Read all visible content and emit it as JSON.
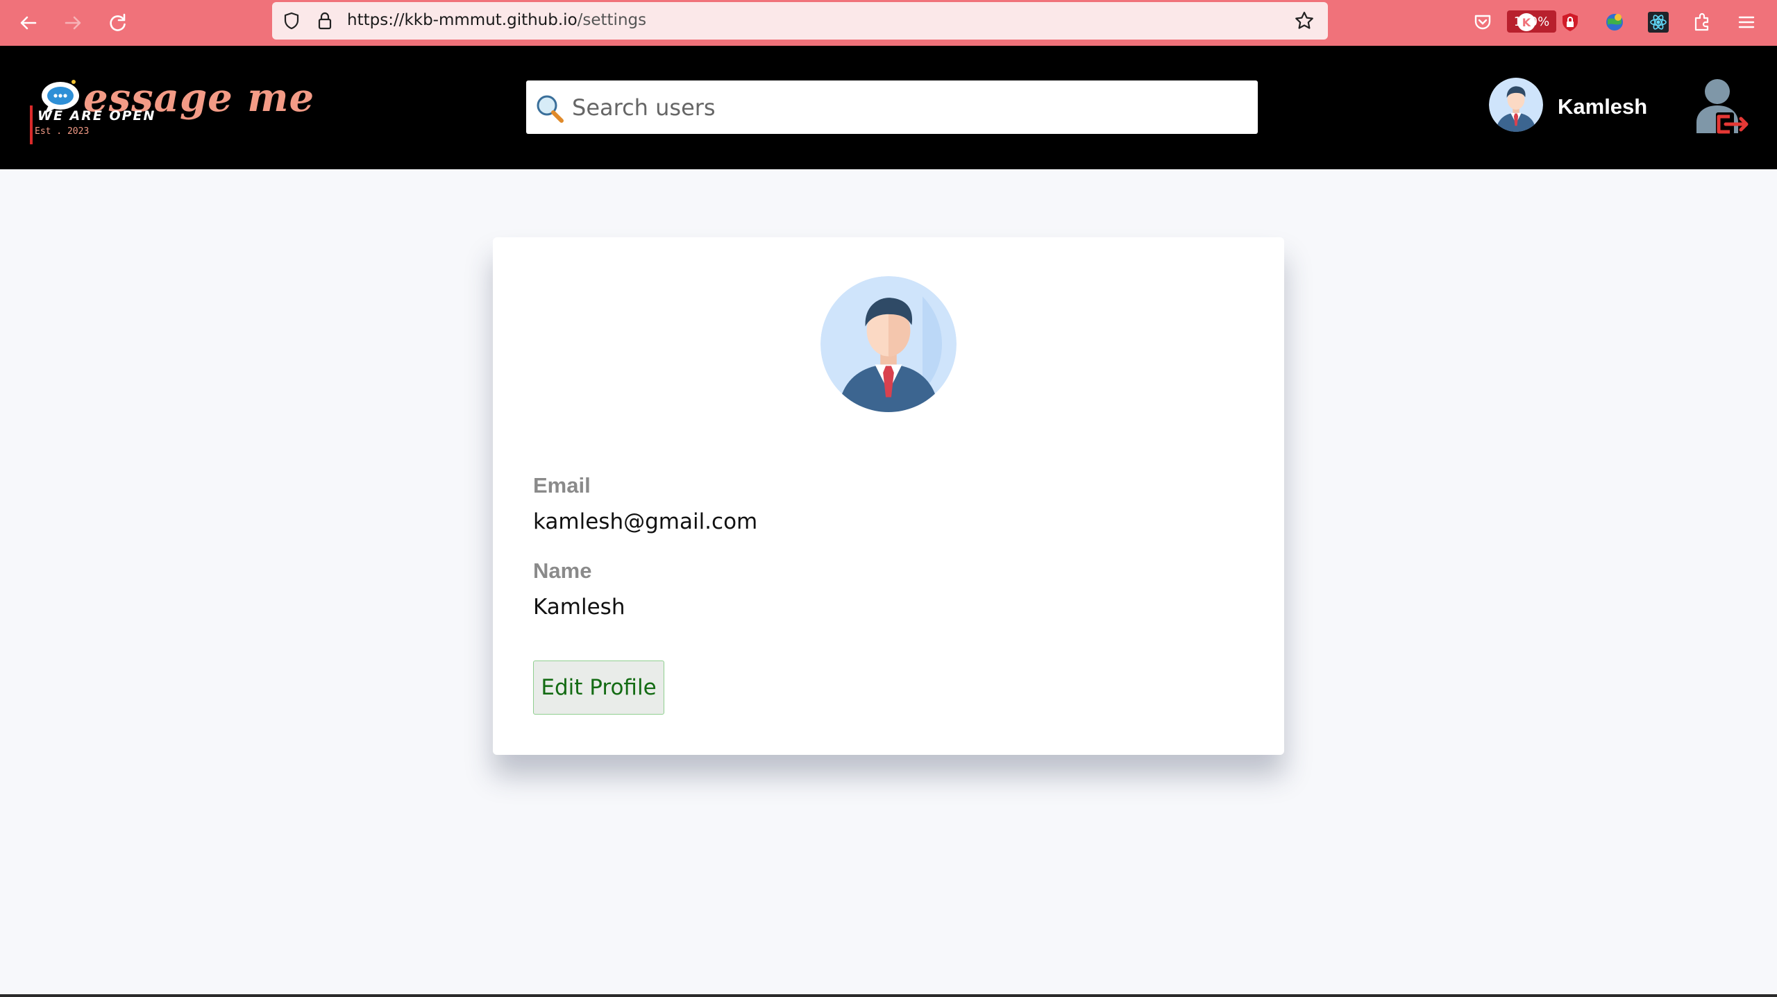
{
  "browser": {
    "url_host": "https://kkb-mmmut.github.io",
    "url_path": "/settings",
    "zoom": "110%",
    "extension_k_label": "K"
  },
  "header": {
    "logo": {
      "title": "essage me",
      "tagline": "WE ARE OPEN",
      "established": "Est . 2023"
    },
    "search": {
      "placeholder": "Search users"
    },
    "user": {
      "name": "Kamlesh"
    }
  },
  "settings": {
    "email_label": "Email",
    "email_value": "kamlesh@gmail.com",
    "name_label": "Name",
    "name_value": "Kamlesh",
    "edit_button": "Edit Profile"
  },
  "colors": {
    "chrome": "#f0727a",
    "header_bg": "#000000",
    "page_bg": "#f7f8fb",
    "logo_accent": "#f39b86",
    "zoom_badge": "#b8202d",
    "edit_text": "#136b13"
  },
  "icons": {
    "back": "arrow-left-icon",
    "forward": "arrow-right-icon",
    "reload": "reload-icon",
    "shield": "shield-icon",
    "lock": "lock-icon",
    "bookmark": "star-icon",
    "pocket": "pocket-icon",
    "extensions": "puzzle-icon",
    "menu": "hamburger-icon",
    "search": "magnifier-icon",
    "logout": "user-logout-icon"
  }
}
